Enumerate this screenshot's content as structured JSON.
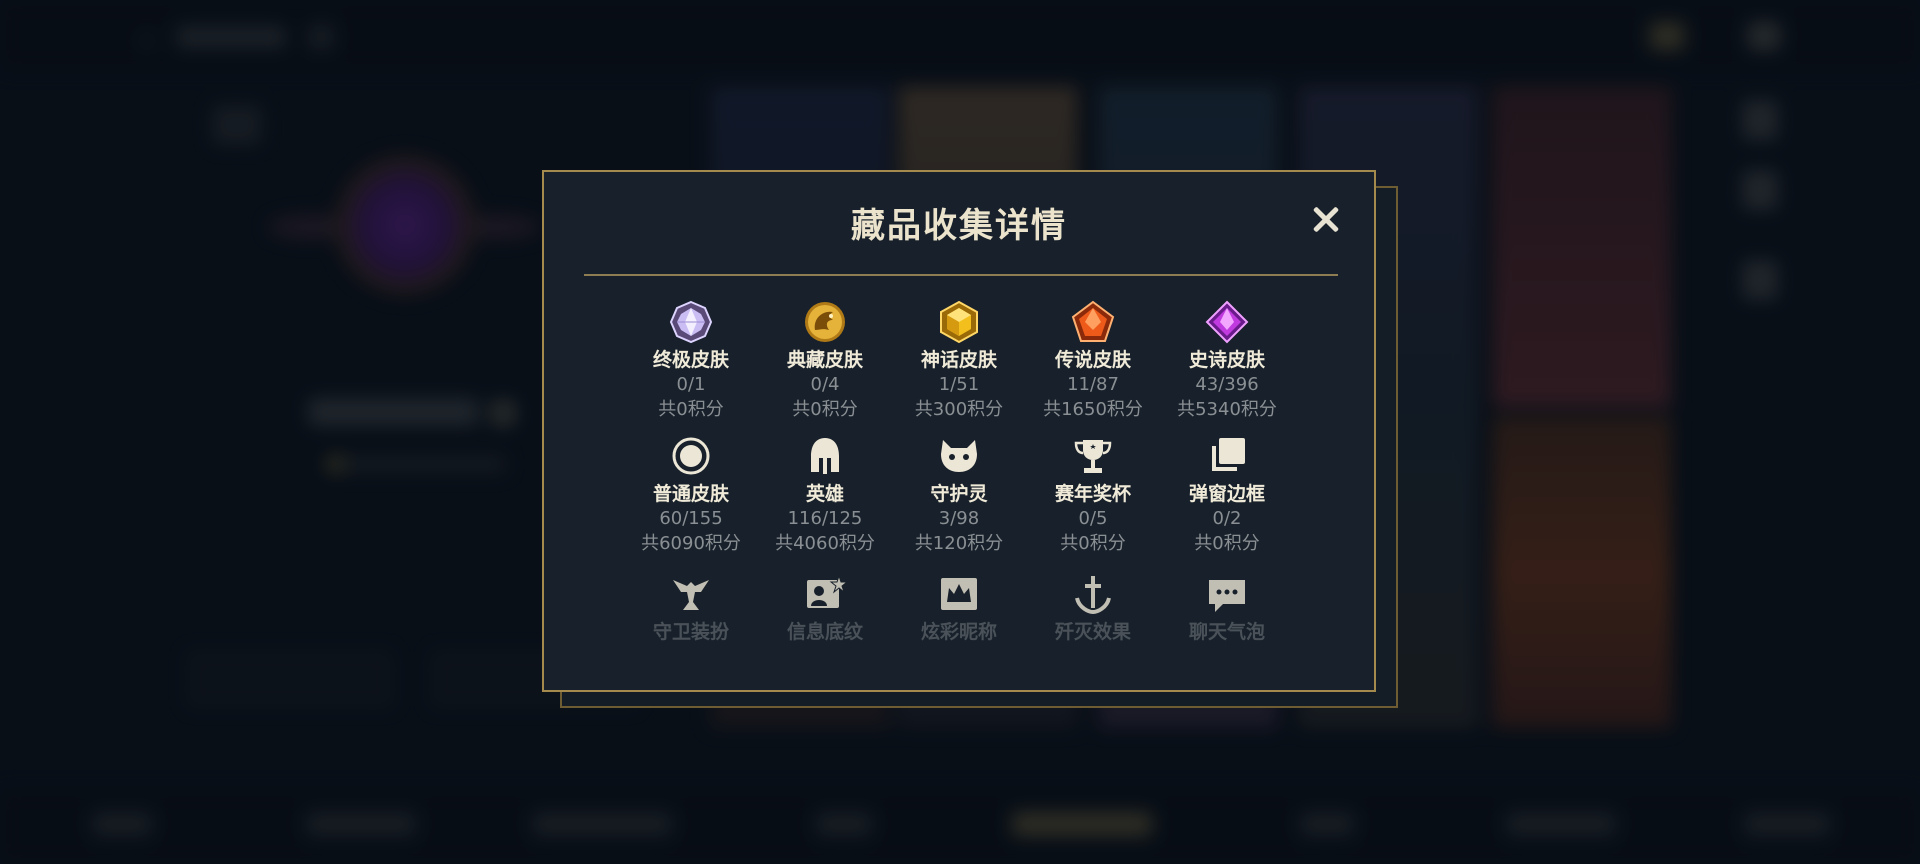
{
  "modal": {
    "title": "藏品收集详情",
    "close_icon": "close-icon"
  },
  "rows": [
    [
      {
        "icon": "ultimate-skin-gem-icon",
        "label": "终极皮肤",
        "count": "0/1",
        "points": "共0积分"
      },
      {
        "icon": "prestige-skin-dragon-icon",
        "label": "典藏皮肤",
        "count": "0/4",
        "points": "共0积分"
      },
      {
        "icon": "mythic-skin-gem-icon",
        "label": "神话皮肤",
        "count": "1/51",
        "points": "共300积分"
      },
      {
        "icon": "legendary-skin-gem-icon",
        "label": "传说皮肤",
        "count": "11/87",
        "points": "共1650积分"
      },
      {
        "icon": "epic-skin-gem-icon",
        "label": "史诗皮肤",
        "count": "43/396",
        "points": "共5340积分"
      }
    ],
    [
      {
        "icon": "standard-skin-circle-icon",
        "label": "普通皮肤",
        "count": "60/155",
        "points": "共6090积分"
      },
      {
        "icon": "champion-helmet-icon",
        "label": "英雄",
        "count": "116/125",
        "points": "共4060积分"
      },
      {
        "icon": "companion-creature-icon",
        "label": "守护灵",
        "count": "3/98",
        "points": "共120积分"
      },
      {
        "icon": "seasonal-trophy-icon",
        "label": "赛年奖杯",
        "count": "0/5",
        "points": "共0积分"
      },
      {
        "icon": "popup-frame-icon",
        "label": "弹窗边框",
        "count": "0/2",
        "points": "共0积分"
      }
    ],
    [
      {
        "icon": "ward-skin-icon",
        "label": "守卫装扮"
      },
      {
        "icon": "profile-banner-icon",
        "label": "信息底纹"
      },
      {
        "icon": "colored-nickname-icon",
        "label": "炫彩昵称"
      },
      {
        "icon": "finisher-effect-anchor-icon",
        "label": "歼灭效果"
      },
      {
        "icon": "chat-bubble-icon",
        "label": "聊天气泡"
      }
    ]
  ],
  "colors": {
    "modal_border": "#a48a4c",
    "modal_bg": "#18212b",
    "label": "#f0ead8",
    "secondary_text": "#8a8f93",
    "ultimate": "#b7a8e8",
    "prestige": "#d9a735",
    "mythic": "#e8b21e",
    "legendary": "#e55a1e",
    "epic": "#b23ad0",
    "icon_light": "#ece6d6"
  }
}
